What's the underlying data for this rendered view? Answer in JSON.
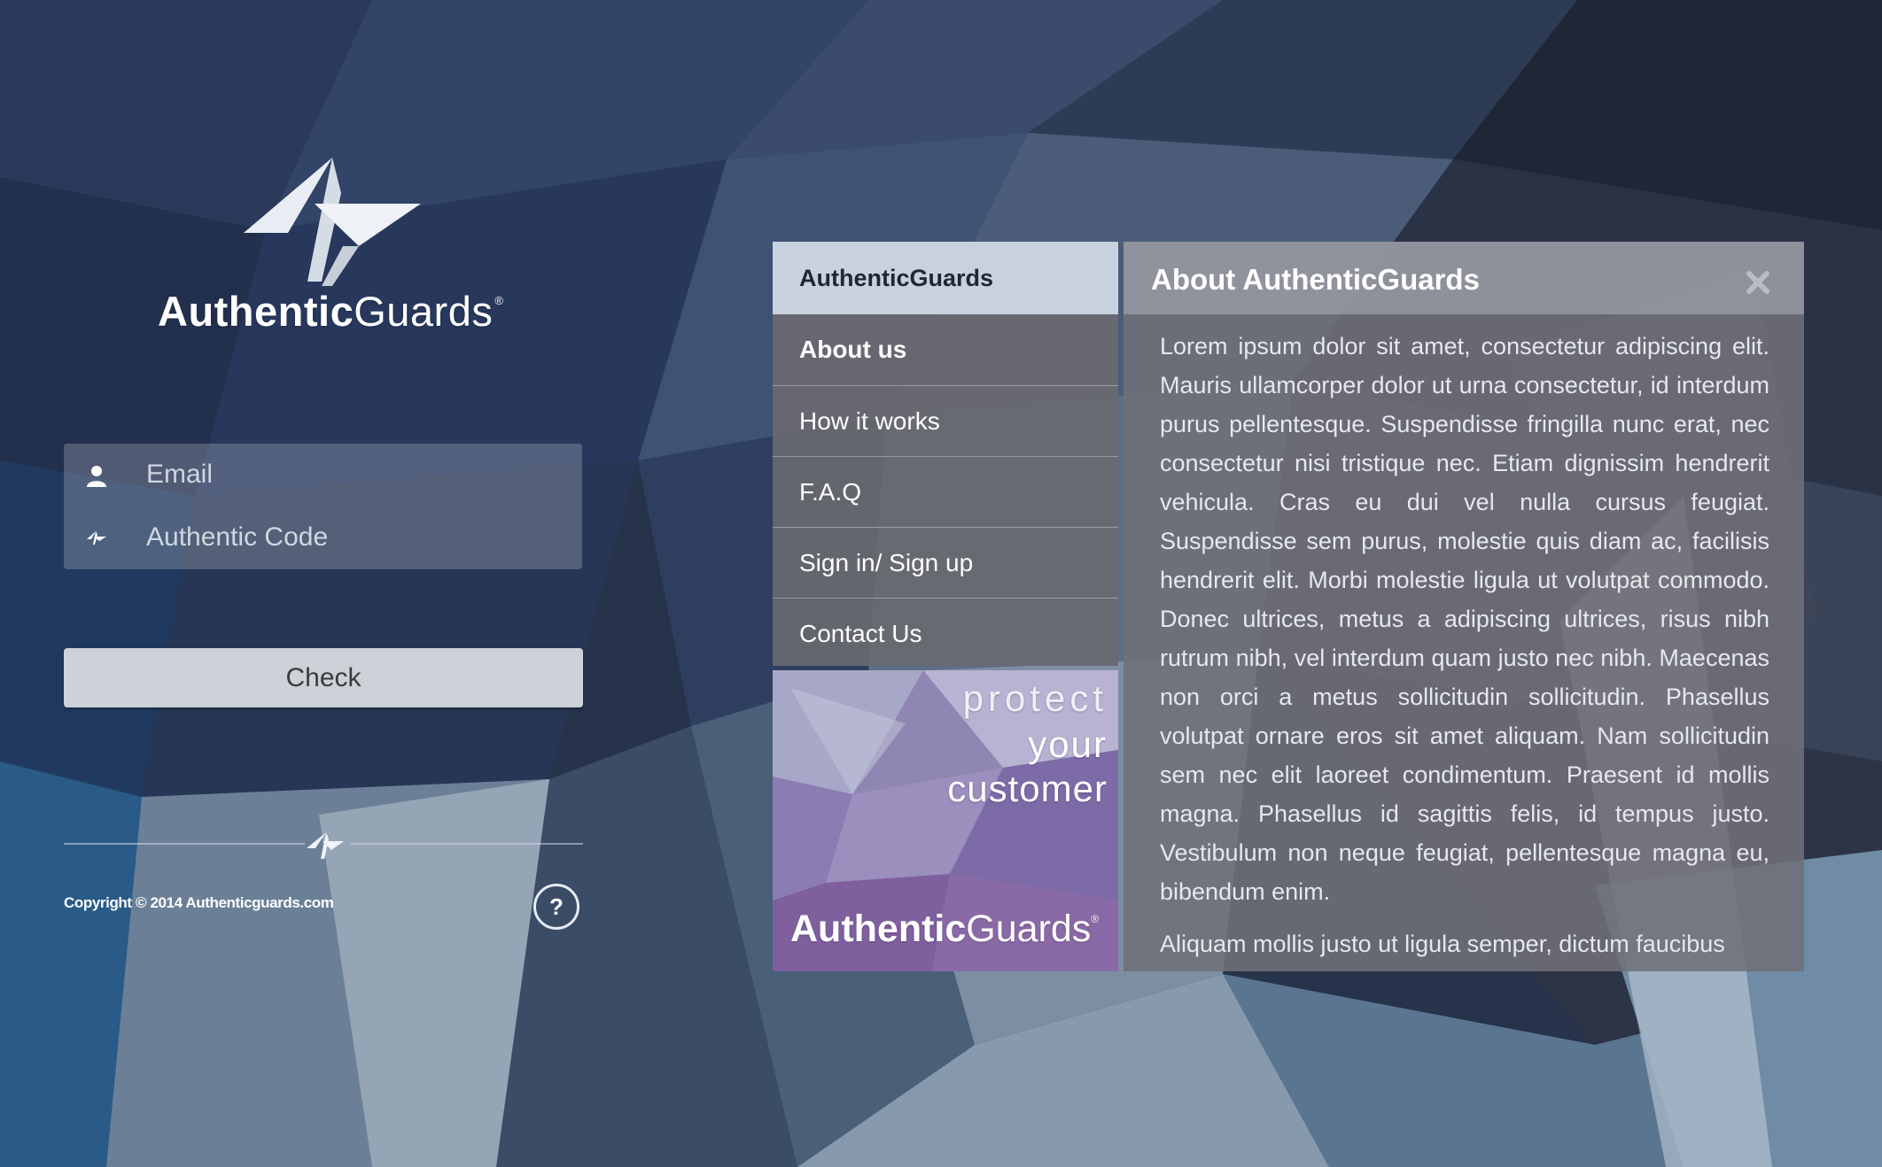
{
  "brand": {
    "name_bold": "Authentic",
    "name_light": "Guards",
    "registered": "®"
  },
  "login": {
    "email_placeholder": "Email",
    "code_placeholder": "Authentic Code",
    "check_label": "Check",
    "icons": {
      "email": "user-icon",
      "code": "bolt-logo-icon"
    }
  },
  "footer": {
    "copyright": "Copyright © 2014 Authenticguards.com",
    "help_label": "?"
  },
  "nav": {
    "header": "AuthenticGuards",
    "items": [
      {
        "label": "About us",
        "active": true
      },
      {
        "label": "How it works"
      },
      {
        "label": "F.A.Q"
      },
      {
        "label": "Sign in/ Sign up"
      },
      {
        "label": "Contact Us"
      }
    ]
  },
  "promo": {
    "line1": "protect",
    "line2": "your",
    "line3": "customer",
    "brand_bold": "Authentic",
    "brand_light": "Guards",
    "registered": "®"
  },
  "panel": {
    "title": "About AuthenticGuards",
    "close_icon": "close-icon",
    "paragraphs": [
      "Lorem ipsum dolor sit amet, consectetur adipiscing elit. Mauris ullamcorper dolor ut urna consectetur, id interdum purus pellentesque. Suspendisse fringilla nunc erat, nec consectetur nisi tristique nec. Etiam dignissim hendrerit vehicula. Cras eu dui vel nulla cursus feugiat. Suspendisse sem purus, molestie quis diam ac, facilisis hendrerit elit. Morbi molestie ligula ut volutpat commodo. Donec ultrices, metus a adipiscing ultrices, risus nibh rutrum nibh, vel interdum quam justo nec nibh. Maecenas non orci a metus sollicitudin sollicitudin. Phasellus volutpat ornare eros sit amet aliquam. Nam sollicitudin sem nec elit laoreet condimentum. Praesent id mollis magna. Phasellus id sagittis felis, id tempus justo. Vestibulum non neque feugiat, pellentesque magna eu, bibendum enim.",
      "Aliquam mollis justo ut ligula semper, dictum faucibus"
    ]
  },
  "colors": {
    "background": "#233047",
    "nav_header": "#c8d2de",
    "nav_body": "#69696f",
    "panel_body": "#707078",
    "check_button": "#cdd1d8"
  }
}
